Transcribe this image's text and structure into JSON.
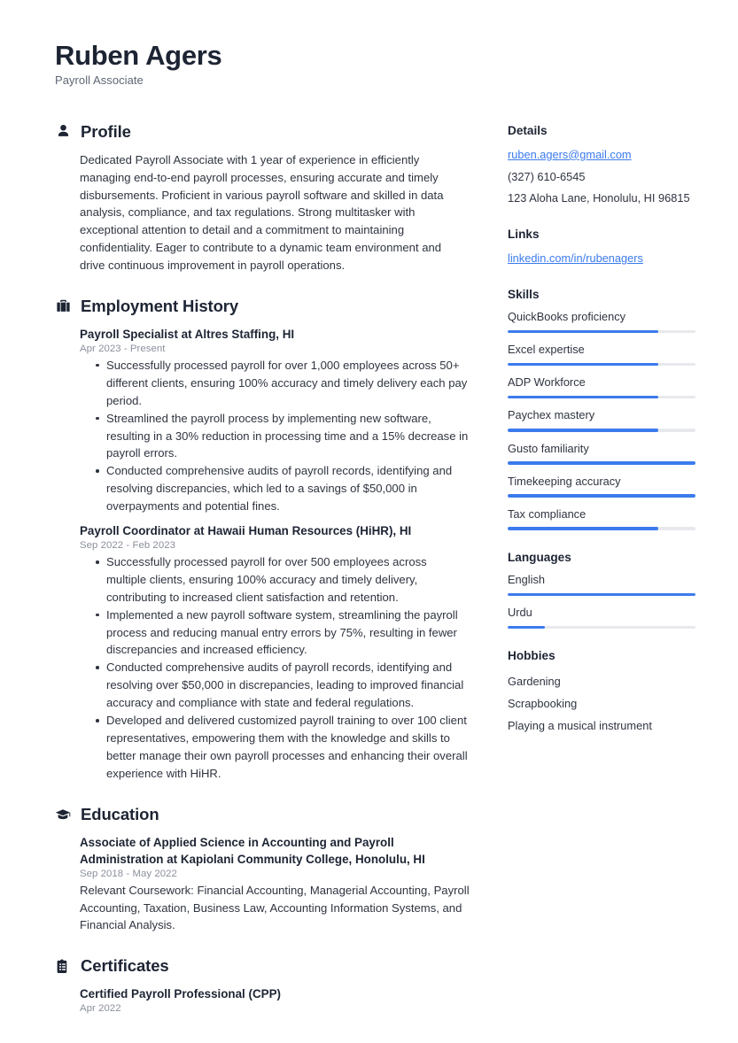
{
  "header": {
    "name": "Ruben Agers",
    "job_title": "Payroll Associate"
  },
  "accent_color": "#3b7bed",
  "text_color": "#2f3440",
  "sections": {
    "profile": {
      "title": "Profile",
      "icon": "person-icon",
      "text": "Dedicated Payroll Associate with 1 year of experience in efficiently managing end-to-end payroll processes, ensuring accurate and timely disbursements. Proficient in various payroll software and skilled in data analysis, compliance, and tax regulations. Strong multitasker with exceptional attention to detail and a commitment to maintaining confidentiality. Eager to contribute to a dynamic team environment and drive continuous improvement in payroll operations."
    },
    "employment": {
      "title": "Employment History",
      "icon": "briefcase-icon",
      "entries": [
        {
          "title": "Payroll Specialist at Altres Staffing, HI",
          "date": "Apr 2023 - Present",
          "bullets": [
            "Successfully processed payroll for over 1,000 employees across 50+ different clients, ensuring 100% accuracy and timely delivery each pay period.",
            "Streamlined the payroll process by implementing new software, resulting in a 30% reduction in processing time and a 15% decrease in payroll errors.",
            "Conducted comprehensive audits of payroll records, identifying and resolving discrepancies, which led to a savings of $50,000 in overpayments and potential fines."
          ]
        },
        {
          "title": "Payroll Coordinator at Hawaii Human Resources (HiHR), HI",
          "date": "Sep 2022 - Feb 2023",
          "bullets": [
            "Successfully processed payroll for over 500 employees across multiple clients, ensuring 100% accuracy and timely delivery, contributing to increased client satisfaction and retention.",
            "Implemented a new payroll software system, streamlining the payroll process and reducing manual entry errors by 75%, resulting in fewer discrepancies and increased efficiency.",
            "Conducted comprehensive audits of payroll records, identifying and resolving over $50,000 in discrepancies, leading to improved financial accuracy and compliance with state and federal regulations.",
            "Developed and delivered customized payroll training to over 100 client representatives, empowering them with the knowledge and skills to better manage their own payroll processes and enhancing their overall experience with HiHR."
          ]
        }
      ]
    },
    "education": {
      "title": "Education",
      "icon": "graduation-cap-icon",
      "entries": [
        {
          "title": "Associate of Applied Science in Accounting and Payroll Administration at Kapiolani Community College, Honolulu, HI",
          "date": "Sep 2018 - May 2022",
          "description": "Relevant Coursework: Financial Accounting, Managerial Accounting, Payroll Accounting, Taxation, Business Law, Accounting Information Systems, and Financial Analysis."
        }
      ]
    },
    "certificates": {
      "title": "Certificates",
      "icon": "clipboard-icon",
      "entries": [
        {
          "title": "Certified Payroll Professional (CPP)",
          "date": "Apr 2022"
        }
      ]
    }
  },
  "sidebar": {
    "details": {
      "title": "Details",
      "email": "ruben.agers@gmail.com",
      "phone": "(327) 610-6545",
      "address": "123 Aloha Lane, Honolulu, HI 96815"
    },
    "links": {
      "title": "Links",
      "items": [
        {
          "label": "linkedin.com/in/rubenagers"
        }
      ]
    },
    "skills": {
      "title": "Skills",
      "items": [
        {
          "label": "QuickBooks proficiency",
          "level": 80
        },
        {
          "label": "Excel expertise",
          "level": 80
        },
        {
          "label": "ADP Workforce",
          "level": 80
        },
        {
          "label": "Paychex mastery",
          "level": 80
        },
        {
          "label": "Gusto familiarity",
          "level": 100
        },
        {
          "label": "Timekeeping accuracy",
          "level": 100
        },
        {
          "label": "Tax compliance",
          "level": 80
        }
      ]
    },
    "languages": {
      "title": "Languages",
      "items": [
        {
          "label": "English",
          "level": 100
        },
        {
          "label": "Urdu",
          "level": 20
        }
      ]
    },
    "hobbies": {
      "title": "Hobbies",
      "items": [
        {
          "label": "Gardening"
        },
        {
          "label": "Scrapbooking"
        },
        {
          "label": "Playing a musical instrument"
        }
      ]
    }
  }
}
